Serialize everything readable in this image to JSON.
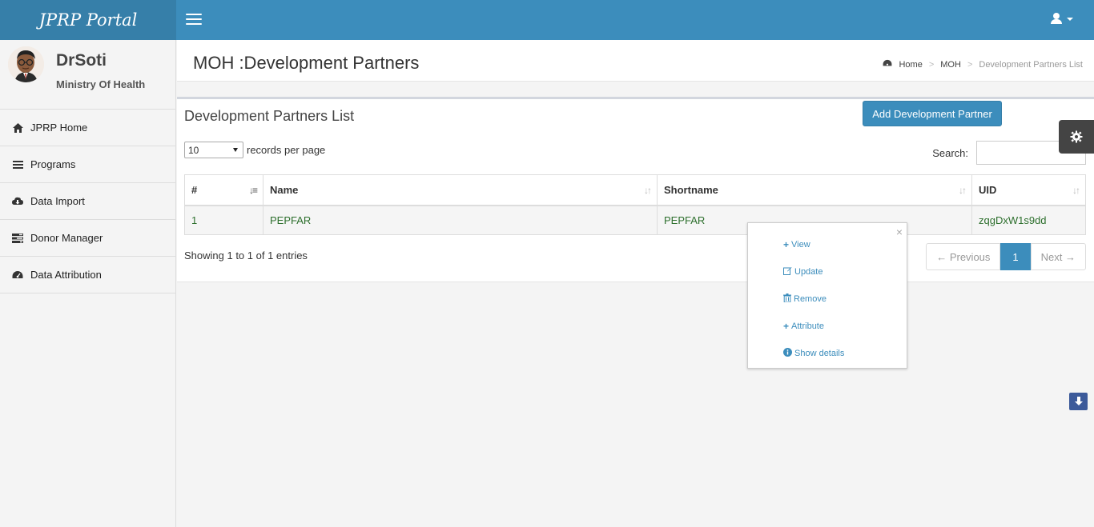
{
  "app": {
    "title": "JPRP Portal"
  },
  "user": {
    "name": "DrSoti",
    "org": "Ministry Of Health"
  },
  "sidebar": {
    "items": [
      {
        "label": "JPRP Home",
        "icon": "home-icon"
      },
      {
        "label": "Programs",
        "icon": "list-icon"
      },
      {
        "label": "Data Import",
        "icon": "cloud-download-icon"
      },
      {
        "label": "Donor Manager",
        "icon": "tasks-icon"
      },
      {
        "label": "Data Attribution",
        "icon": "dashboard-icon"
      }
    ]
  },
  "header": {
    "title": "MOH :Development Partners",
    "breadcrumb": [
      "Home",
      "MOH",
      "Development Partners List"
    ]
  },
  "box": {
    "title": "Development Partners List",
    "add_label": "Add Development Partner",
    "length_value": "10",
    "length_suffix": "records per page",
    "search_label": "Search:",
    "search_value": ""
  },
  "table": {
    "columns": [
      "#",
      "Name",
      "Shortname",
      "UID"
    ],
    "rows": [
      [
        "1",
        "PEPFAR",
        "PEPFAR",
        "zqgDxW1s9dd"
      ]
    ],
    "info": "Showing 1 to 1 of 1 entries"
  },
  "pager": {
    "prev": "← Previous",
    "current": "1",
    "next": "Next →"
  },
  "popup": {
    "items": [
      {
        "label": "View",
        "icon": "plus-icon"
      },
      {
        "label": "Update",
        "icon": "edit-icon"
      },
      {
        "label": "Remove",
        "icon": "trash-icon"
      },
      {
        "label": "Attribute",
        "icon": "plus-icon"
      },
      {
        "label": "Show details",
        "icon": "info-circle-icon"
      }
    ]
  },
  "colors": {
    "brand": "#3c8dbc",
    "brand_dark": "#367fa9",
    "cell_text": "#2d6f2d"
  }
}
